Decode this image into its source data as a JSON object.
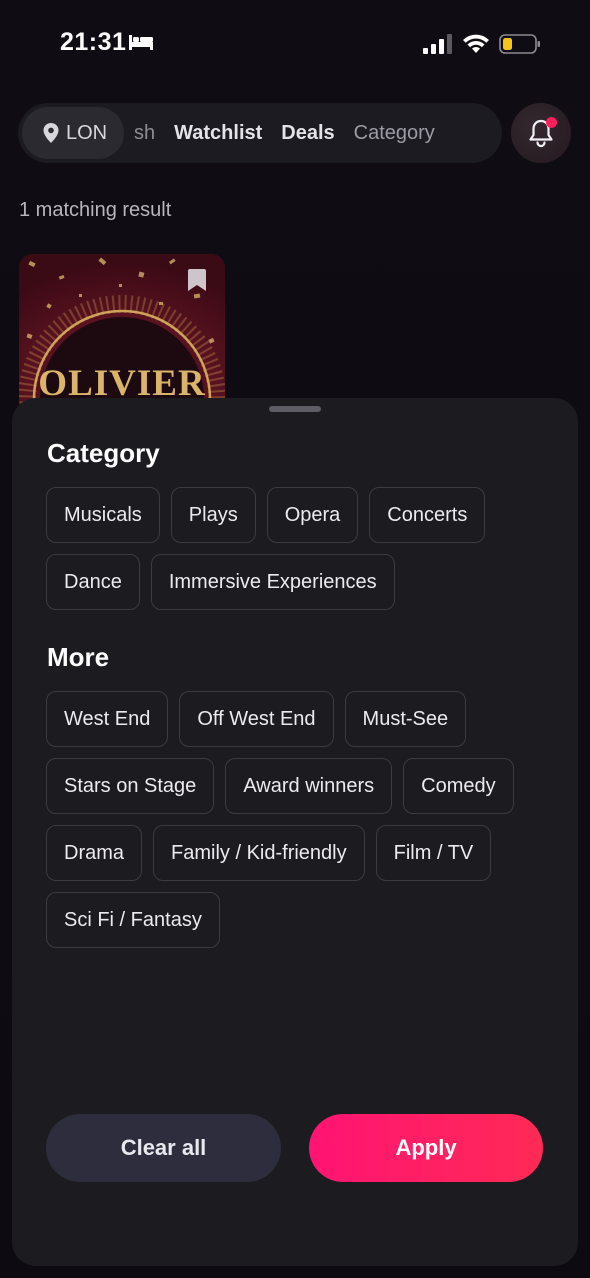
{
  "status_bar": {
    "time": "21:31",
    "icons": [
      "bed-icon",
      "signal-icon",
      "wifi-icon",
      "battery-icon"
    ],
    "battery_color": "#f5c518"
  },
  "top_nav": {
    "location": "LON",
    "tabs": [
      "sh",
      "Watchlist",
      "Deals",
      "Category"
    ]
  },
  "results": {
    "count_text": "1 matching result",
    "poster_title": "OLIVIER"
  },
  "sheet": {
    "category_title": "Category",
    "category_chips": [
      "Musicals",
      "Plays",
      "Opera",
      "Concerts",
      "Dance",
      "Immersive Experiences"
    ],
    "more_title": "More",
    "more_chips": [
      "West End",
      "Off West End",
      "Must-See",
      "Stars on Stage",
      "Award winners",
      "Comedy",
      "Drama",
      "Family / Kid-friendly",
      "Film / TV",
      "Sci Fi / Fantasy"
    ],
    "clear_label": "Clear all",
    "apply_label": "Apply"
  },
  "colors": {
    "accent": "#ff1f5c",
    "sheet_bg": "#1b1b20",
    "clear_button_bg": "#2d2d3d"
  }
}
